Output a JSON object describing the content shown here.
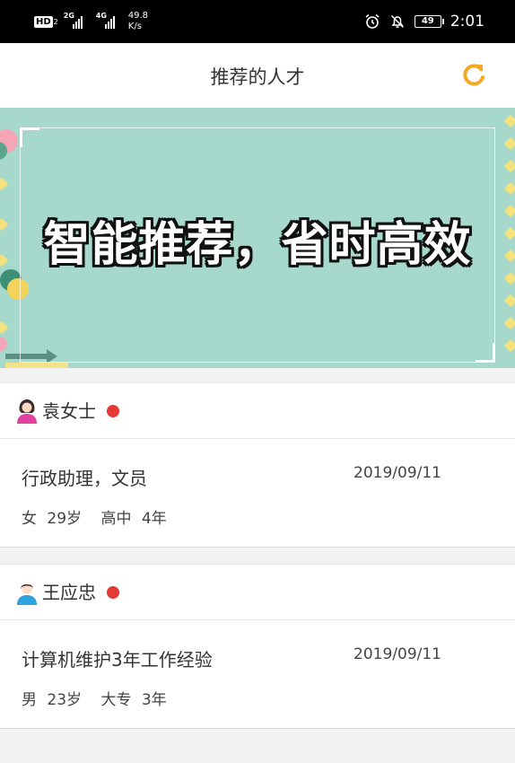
{
  "status_bar": {
    "hd_label": "HD",
    "hd_sub": "2",
    "net1": "2G",
    "net2": "4G",
    "speed_value": "49.8",
    "speed_unit": "K/s",
    "battery": "49",
    "time": "2:01"
  },
  "header": {
    "title": "推荐的人才",
    "refresh_icon": "refresh-icon",
    "accent_color": "#f5a623"
  },
  "banner": {
    "slogan": "智能推荐，省时高效",
    "bg_color": "#a6d9cc"
  },
  "candidates": [
    {
      "name": "袁女士",
      "avatar_icon": "female-avatar-icon",
      "job": "行政助理，文员",
      "date": "2019/09/11",
      "gender": "女",
      "age": "29岁",
      "education": "高中",
      "experience": "4年"
    },
    {
      "name": "王应忠",
      "avatar_icon": "male-avatar-icon",
      "job": "计算机维护3年工作经验",
      "date": "2019/09/11",
      "gender": "男",
      "age": "23岁",
      "education": "大专",
      "experience": "3年"
    }
  ]
}
